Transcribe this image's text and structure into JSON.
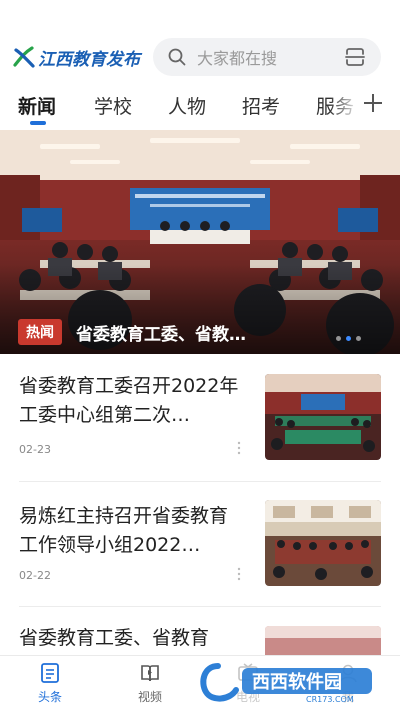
{
  "header": {
    "logo_text": "江西教育发布",
    "search_placeholder": "大家都在搜"
  },
  "tabs": [
    {
      "label": "新闻",
      "active": true
    },
    {
      "label": "学校",
      "active": false
    },
    {
      "label": "人物",
      "active": false
    },
    {
      "label": "招考",
      "active": false
    },
    {
      "label": "服务",
      "active": false
    }
  ],
  "banner": {
    "badge": "热闻",
    "caption": "省委教育工委、省教…",
    "slide_count": 3,
    "current_slide": 2
  },
  "news": [
    {
      "title": "省委教育工委召开2022年工委中心组第二次…",
      "date": "02-23"
    },
    {
      "title": "易炼红主持召开省委教育工作领导小组2022…",
      "date": "02-22"
    },
    {
      "title": "省委教育工委、省教育",
      "date": ""
    }
  ],
  "bottom_nav": [
    {
      "label": "头条",
      "icon": "article-icon",
      "active": true
    },
    {
      "label": "视频",
      "icon": "video-book-icon",
      "active": false
    },
    {
      "label": "电视",
      "icon": "tv-icon",
      "active": false
    },
    {
      "label": "我",
      "icon": "profile-icon",
      "active": false
    }
  ],
  "watermark": {
    "text": "西西软件园",
    "subtext": "CR173.COM"
  },
  "colors": {
    "accent": "#1f6fd9",
    "hot_badge": "#c9392e",
    "logo": "#1a5fb4"
  }
}
